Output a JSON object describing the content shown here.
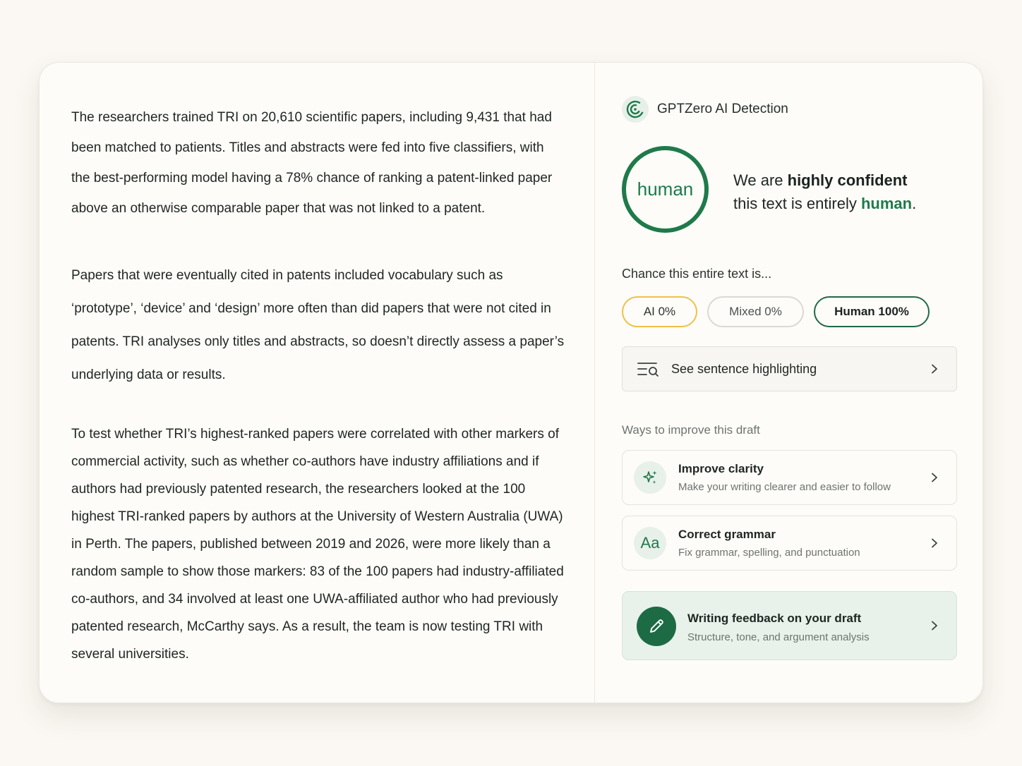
{
  "article": {
    "paragraphs": [
      "The researchers trained TRI on 20,610 scientific papers, including 9,431 that had been matched to patients. Titles and abstracts were fed into five classifiers, with the best-performing model having a 78% chance of ranking a patent-linked paper above an otherwise comparable paper that was not linked to a patent.",
      "Papers that were eventually cited in patents included vocabulary such as ‘prototype’, ‘device’ and ‘design’ more often than did papers that were not cited in patents. TRI analyses only titles and abstracts, so doesn’t directly assess a paper’s underlying data or results.",
      "To test whether TRI’s highest-ranked papers were correlated with other markers of commercial activity, such as whether co-authors have industry affiliations and if authors had previously patented research, the researchers looked at the 100 highest TRI-ranked papers by authors at the University of Western Australia (UWA) in Perth. The papers, published between 2019 and 2026, were more likely than a random sample to show those markers: 83 of the 100 papers had industry-affiliated co-authors, and 34 involved at least one UWA-affiliated author who had previously patented research, McCarthy says. As a result, the team is now testing TRI with several universities."
    ]
  },
  "detector": {
    "brand_icon": "gptzero-logo-icon",
    "title": "GPTZero AI Detection",
    "verdict_label": "human",
    "confidence": {
      "prefix": "We are ",
      "emphasis": "highly confident",
      "middle": "this text is entirely ",
      "result": "human",
      "suffix": "."
    },
    "chance_label": "Chance this entire text is...",
    "scores": {
      "ai": "AI 0%",
      "mixed": "Mixed 0%",
      "human": "Human 100%"
    },
    "highlight": {
      "icon": "search-lines-icon",
      "label": "See sentence highlighting"
    },
    "ways_label": "Ways to improve this draft",
    "tools": {
      "clarity": {
        "icon": "sparkle-icon",
        "title": "Improve clarity",
        "subtitle": "Make your writing clearer and easier to follow"
      },
      "grammar": {
        "icon": "Aa",
        "title": "Correct grammar",
        "subtitle": "Fix grammar, spelling, and punctuation"
      },
      "feedback": {
        "icon": "pencil-icon",
        "title": "Writing feedback on your draft",
        "subtitle": "Structure, tone, and argument analysis"
      }
    },
    "colors": {
      "accent_green": "#1f7a4a",
      "ai_yellow": "#f0c04a",
      "background": "#fbf8f3"
    }
  }
}
